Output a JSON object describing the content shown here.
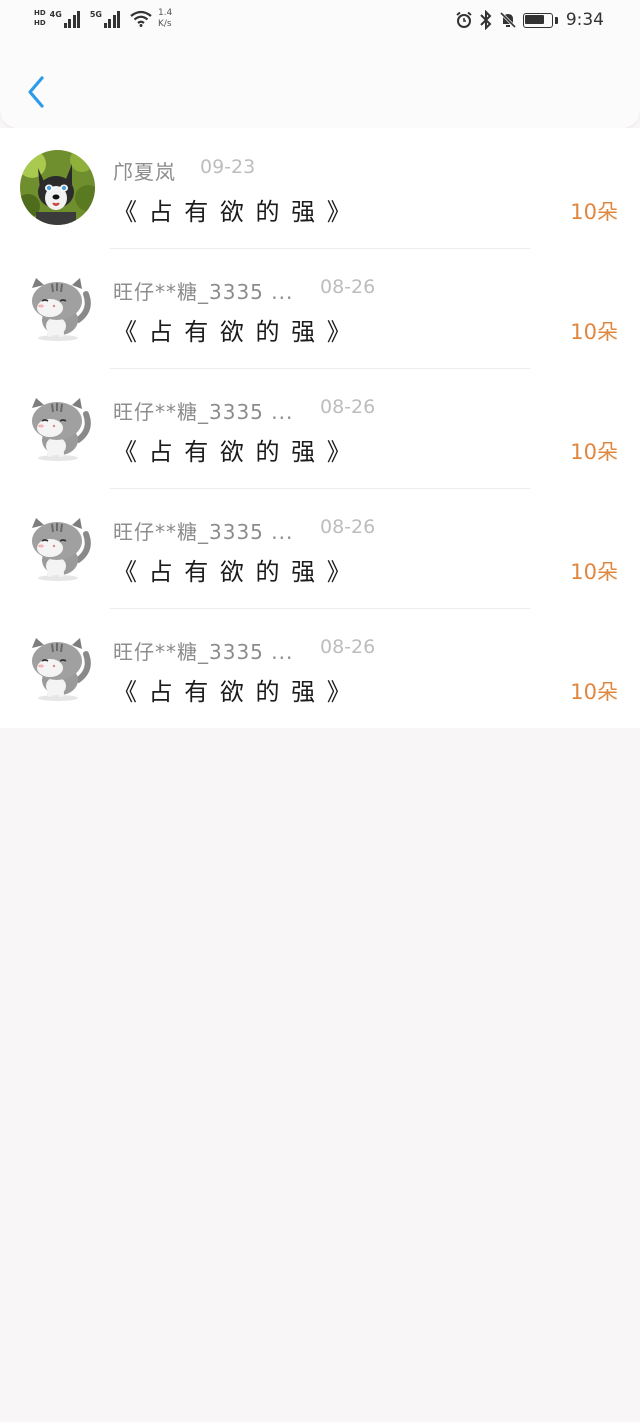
{
  "status_bar": {
    "hd1": "HD",
    "hd2": "HD",
    "net1": "4G",
    "net2": "5G",
    "speed_value": "1.4",
    "speed_unit": "K/s",
    "time": "9:34",
    "icons": [
      "alarm-icon",
      "bluetooth-icon",
      "mute-icon",
      "battery-icon"
    ]
  },
  "nav": {
    "back_icon": "chevron-left-icon",
    "accent_color": "#2d9be8"
  },
  "colors": {
    "amount": "#e0873f",
    "username": "#8c8c8c",
    "date": "#bdbdbd",
    "page_bg": "#f8f6f7"
  },
  "records": [
    {
      "username": "邝夏岚",
      "date": "09-23",
      "title": "《 占 有 欲 的 强 》",
      "amount": "10朵",
      "avatar": "husky-dog-avatar"
    },
    {
      "username": "旺仔**糖_3335 ...",
      "date": "08-26",
      "title": "《 占 有 欲 的 强 》",
      "amount": "10朵",
      "avatar": "gray-cat-avatar"
    },
    {
      "username": "旺仔**糖_3335 ...",
      "date": "08-26",
      "title": "《 占 有 欲 的 强 》",
      "amount": "10朵",
      "avatar": "gray-cat-avatar"
    },
    {
      "username": "旺仔**糖_3335 ...",
      "date": "08-26",
      "title": "《 占 有 欲 的 强 》",
      "amount": "10朵",
      "avatar": "gray-cat-avatar"
    },
    {
      "username": "旺仔**糖_3335 ...",
      "date": "08-26",
      "title": "《 占 有 欲 的 强 》",
      "amount": "10朵",
      "avatar": "gray-cat-avatar"
    }
  ]
}
